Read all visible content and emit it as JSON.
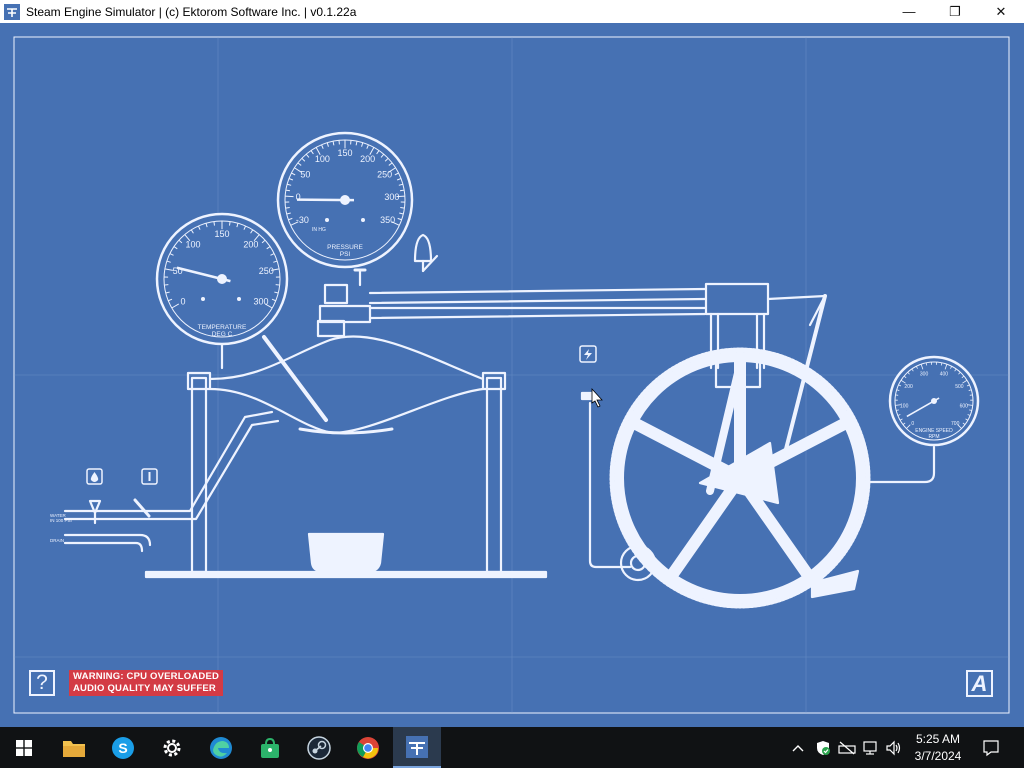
{
  "window": {
    "title": "Steam Engine Simulator | (c) Ektorom Software Inc. | v0.1.22a",
    "minimize_glyph": "—",
    "restore_glyph": "❐",
    "close_glyph": "✕"
  },
  "gauges": {
    "temperature": {
      "label_line1": "TEMPERATURE",
      "label_line2": "DEG C",
      "ticks": [
        "0",
        "50",
        "100",
        "150",
        "200",
        "250",
        "300"
      ],
      "needle_value": 55
    },
    "pressure": {
      "label_line1": "PRESSURE",
      "label_line2": "PSI",
      "ticks": [
        "-30",
        "0",
        "50",
        "100",
        "150",
        "200",
        "250",
        "300",
        "350"
      ],
      "inhg_label": "IN HG",
      "needle_value": 12
    },
    "engine_speed": {
      "label_line1": "ENGINE SPEED",
      "label_line2": "RPM",
      "ticks": [
        "0",
        "100",
        "200",
        "300",
        "400",
        "500",
        "600",
        "700"
      ],
      "needle_value": 40
    }
  },
  "pipes": {
    "water_label_line1": "WATER",
    "water_label_line2": "IN 100 PSI",
    "drain_label": "DRAIN"
  },
  "controls": {
    "water_icon": "water-drop-icon",
    "valve_icon": "valve-icon",
    "power_icon": "lightning-icon"
  },
  "ui": {
    "help_label": "?",
    "warning_line1": "WARNING: CPU OVERLOADED",
    "warning_line2": "AUDIO QUALITY MAY SUFFER",
    "a_label": "A"
  },
  "clock": {
    "time": "5:25 AM",
    "date": "3/7/2024"
  },
  "colors": {
    "blueprint": "#4671b3",
    "line": "#eef3ff",
    "warning": "#d33b45",
    "taskbar": "#101214"
  }
}
